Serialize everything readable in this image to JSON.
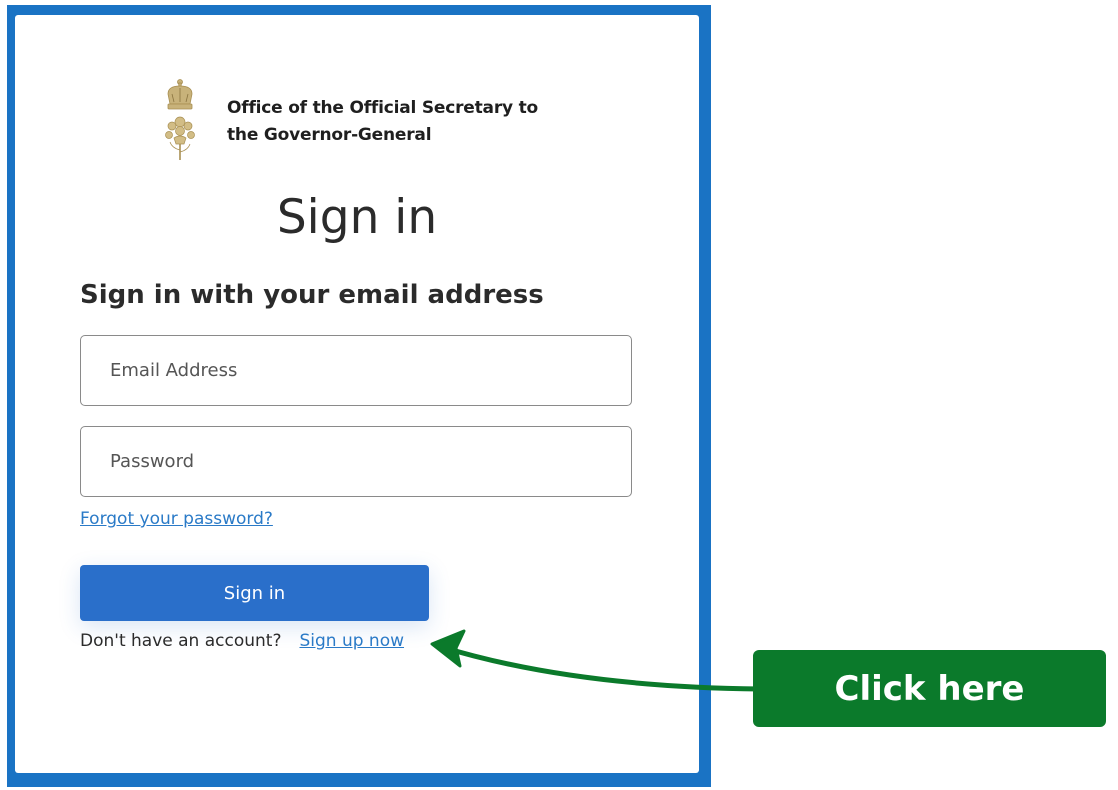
{
  "organization": {
    "name_line1": "Office of the Official Secretary to",
    "name_line2": "the Governor-General",
    "logo_icon": "crown-crest-icon"
  },
  "page": {
    "title": "Sign in",
    "subtitle": "Sign in with your email address"
  },
  "form": {
    "email_placeholder": "Email Address",
    "email_value": "",
    "password_placeholder": "Password",
    "password_value": "",
    "forgot_link": "Forgot your password?",
    "submit_label": "Sign in",
    "no_account_text": "Don't have an account?",
    "signup_link": "Sign up now"
  },
  "annotation": {
    "callout_label": "Click here",
    "arrow_icon": "arrow-left-icon"
  },
  "colors": {
    "frame_blue": "#1a73c4",
    "button_blue": "#2a6fca",
    "link_blue": "#2a7ac7",
    "callout_green": "#0b7a2b",
    "crest_gold": "#c8b27a"
  }
}
